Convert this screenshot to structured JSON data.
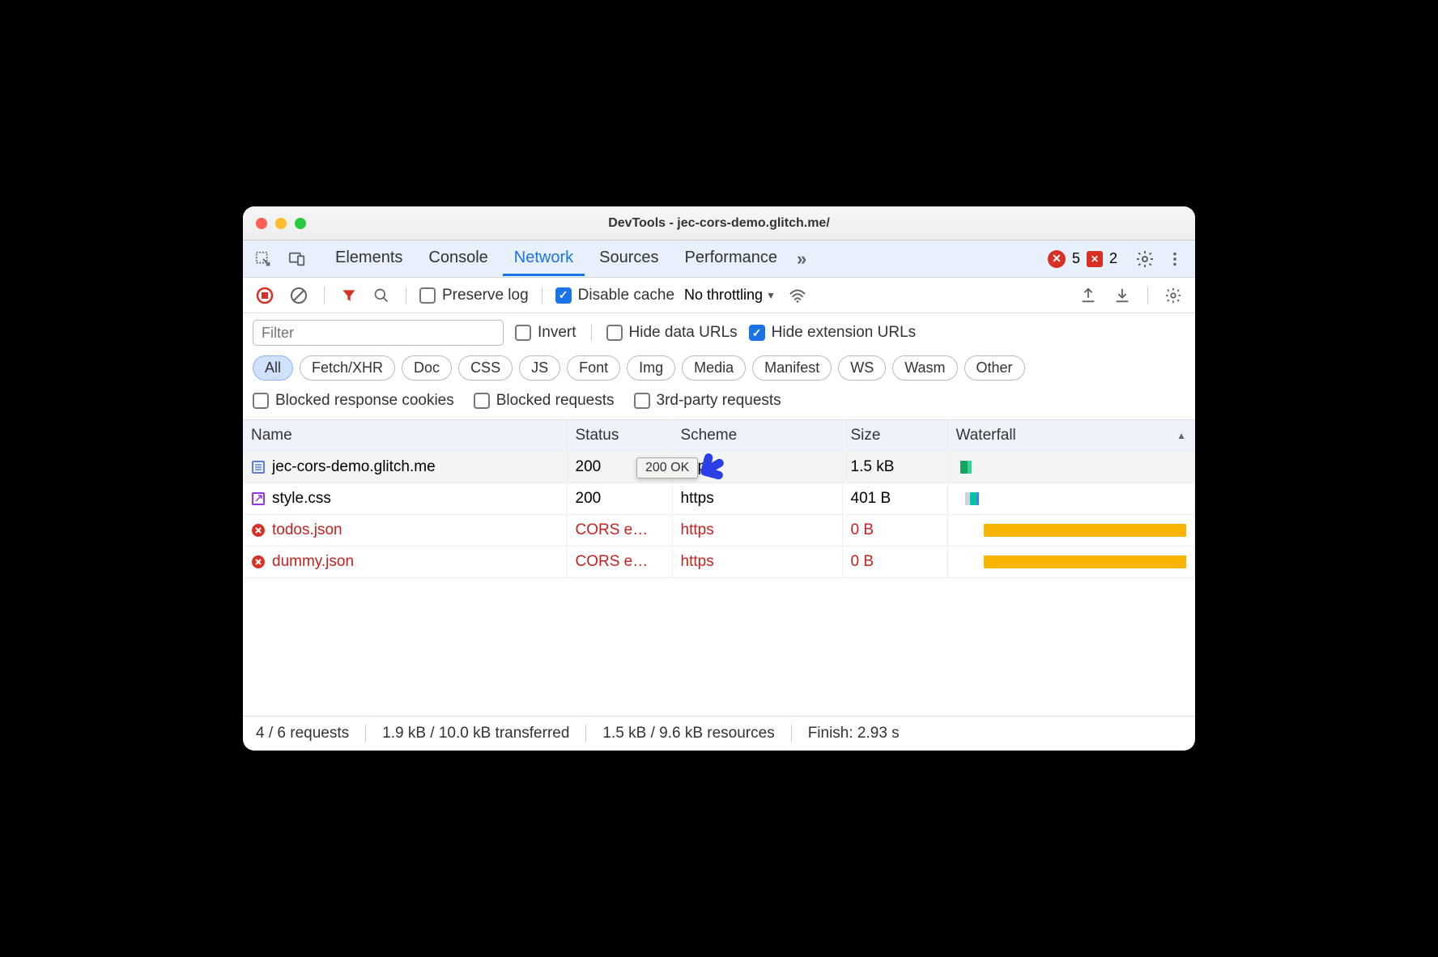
{
  "title": "DevTools - jec-cors-demo.glitch.me/",
  "tabs": [
    "Elements",
    "Console",
    "Network",
    "Sources",
    "Performance"
  ],
  "active_tab": "Network",
  "more_tabs_glyph": "»",
  "errors": {
    "count1": "5",
    "count2": "2"
  },
  "toolbar": {
    "preserve_log": "Preserve log",
    "disable_cache": "Disable cache",
    "throttling": "No throttling"
  },
  "filter": {
    "placeholder": "Filter",
    "invert": "Invert",
    "hide_data_urls": "Hide data URLs",
    "hide_ext_urls": "Hide extension URLs"
  },
  "pills": [
    "All",
    "Fetch/XHR",
    "Doc",
    "CSS",
    "JS",
    "Font",
    "Img",
    "Media",
    "Manifest",
    "WS",
    "Wasm",
    "Other"
  ],
  "active_pill": "All",
  "extra": {
    "blocked_cookies": "Blocked response cookies",
    "blocked_requests": "Blocked requests",
    "third_party": "3rd-party requests"
  },
  "columns": {
    "name": "Name",
    "status": "Status",
    "scheme": "Scheme",
    "size": "Size",
    "waterfall": "Waterfall"
  },
  "tooltip": "200 OK",
  "rows": [
    {
      "icon": "doc",
      "name": "jec-cors-demo.glitch.me",
      "status": "200",
      "scheme": "https",
      "size": "1.5 kB",
      "err": false,
      "wf": [
        {
          "l": 2,
          "w": 3,
          "c": "#1aa260"
        },
        {
          "l": 5,
          "w": 2,
          "c": "#34d399"
        }
      ]
    },
    {
      "icon": "css",
      "name": "style.css",
      "status": "200",
      "scheme": "https",
      "size": "401 B",
      "err": false,
      "wf": [
        {
          "l": 4,
          "w": 2,
          "c": "#cfd4da"
        },
        {
          "l": 6,
          "w": 3,
          "c": "#00c4a7"
        },
        {
          "l": 9,
          "w": 1,
          "c": "#3b82f6"
        }
      ]
    },
    {
      "icon": "err",
      "name": "todos.json",
      "status": "CORS e…",
      "scheme": "https",
      "size": "0 B",
      "err": true,
      "wf": [
        {
          "l": 12,
          "w": 88,
          "c": "#f7b500"
        }
      ]
    },
    {
      "icon": "err",
      "name": "dummy.json",
      "status": "CORS e…",
      "scheme": "https",
      "size": "0 B",
      "err": true,
      "wf": [
        {
          "l": 12,
          "w": 88,
          "c": "#f7b500"
        }
      ]
    }
  ],
  "footer": {
    "requests": "4 / 6 requests",
    "transferred": "1.9 kB / 10.0 kB transferred",
    "resources": "1.5 kB / 9.6 kB resources",
    "finish": "Finish: 2.93 s"
  }
}
